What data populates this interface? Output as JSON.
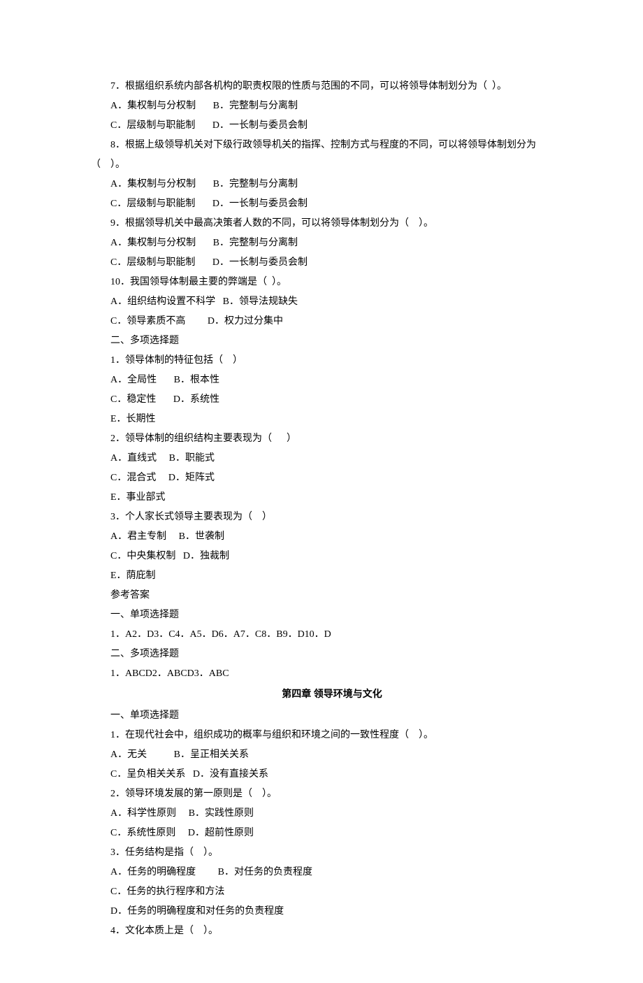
{
  "lines": [
    "7．根据组织系统内部各机构的职责权限的性质与范围的不同，可以将领导体制划分为（  ）。",
    "A．集权制与分权制       B．完整制与分离制",
    "C．层级制与职能制       D．一长制与委员会制",
    "8．根据上级领导机关对下级行政领导机关的指挥、控制方式与程度的不同，可以将领导体制划分为"
  ],
  "hang": "（    ）。",
  "lines2": [
    "A．集权制与分权制       B．完整制与分离制",
    "C．层级制与职能制       D．一长制与委员会制",
    "9．根据领导机关中最高决策者人数的不同，可以将领导体制划分为（    ）。",
    "A．集权制与分权制       B．完整制与分离制",
    "C．层级制与职能制       D．一长制与委员会制",
    "10．我国领导体制最主要的弊端是（  ）。",
    "A．组织结构设置不科学   B．领导法规缺失",
    "C．领导素质不高         D．权力过分集中",
    "二、多项选择题",
    "1．领导体制的特征包括（    ）",
    "A．全局性       B．根本性",
    "C．稳定性       D．系统性",
    "E．长期性",
    "2．领导体制的组织结构主要表现为（      ）",
    "A．直线式     B．职能式",
    "C．混合式     D．矩阵式",
    "E．事业部式",
    "3．个人家长式领导主要表现为（    ）",
    "A．君主专制     B．世袭制",
    "C．中央集权制   D．独裁制",
    "E．荫庇制",
    "参考答案",
    "一、单项选择题",
    "1．A2．D3．C4．A5．D6．A7．C8．B9．D10．D",
    "二、多项选择题",
    "1．ABCD2．ABCD3．ABC"
  ],
  "chapter": "第四章      领导环境与文化",
  "lines3": [
    "一、单项选择题",
    "1．在现代社会中，组织成功的概率与组织和环境之间的一致性程度（    ）。",
    "A．无关           B．呈正相关关系",
    "C．呈负相关关系   D．没有直接关系",
    "2．领导环境发展的第一原则是（    ）。",
    "A．科学性原则     B．实践性原则",
    "C．系统性原则     D．超前性原则",
    "3．任务结构是指（    ）。",
    "A．任务的明确程度         B．对任务的负责程度",
    "C．任务的执行程序和方法",
    "D．任务的明确程度和对任务的负责程度",
    "4．文化本质上是（    ）。"
  ]
}
